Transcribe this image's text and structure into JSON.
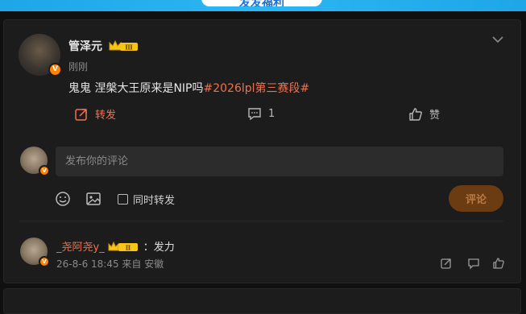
{
  "banner": {
    "label": "发发福利"
  },
  "post": {
    "author": "管泽元",
    "level_badge": "Ⅲ",
    "time": "刚刚",
    "text": "鬼鬼 涅槃大王原来是NIP吗",
    "hashtag": "#2026lpl第三赛段#",
    "actions": {
      "repost_label": "转发",
      "comment_count": "1",
      "like_label": "赞"
    }
  },
  "composer": {
    "placeholder": "发布你的评论",
    "also_repost_label": "同时转发",
    "submit_label": "评论"
  },
  "reply": {
    "user": "_尧阿尧y_",
    "level_badge": "Ⅱ",
    "separator": "：",
    "text": "发力",
    "meta": "26-8-6 18:45 来自 安徽"
  },
  "colors": {
    "accent": "#eb7350",
    "verified": "#ff8200",
    "submit_bg": "#6b3b12"
  }
}
